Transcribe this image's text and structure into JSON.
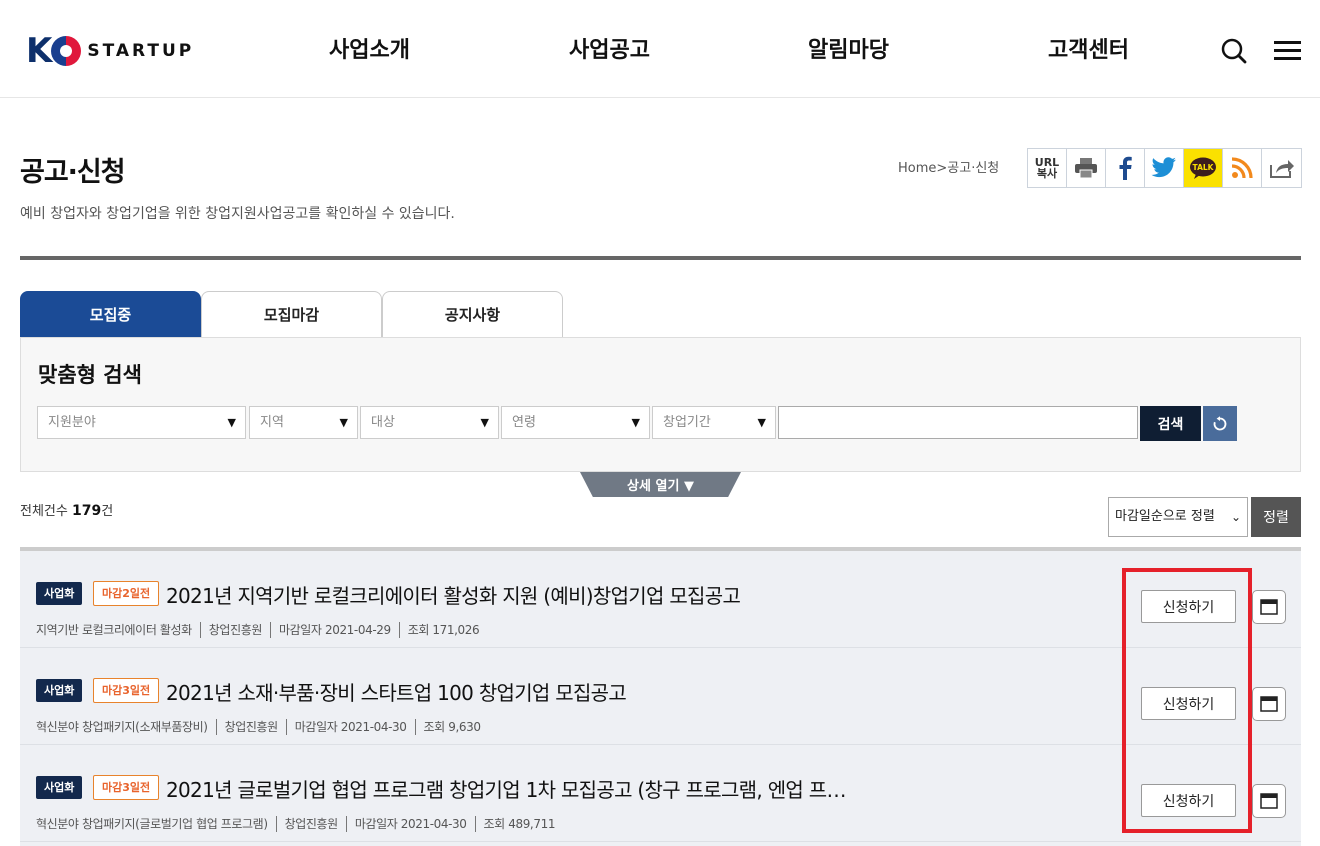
{
  "header": {
    "logo_text": "STARTUP",
    "logo_letter": "K",
    "nav": [
      "사업소개",
      "사업공고",
      "알림마당",
      "고객센터"
    ],
    "icons": [
      "search-icon",
      "menu-icon"
    ]
  },
  "page": {
    "title": "공고·신청",
    "description": "예비 창업자와 창업기업을 위한 창업지원사업공고를 확인하실 수 있습니다.",
    "breadcrumb": "Home>공고·신청",
    "share": {
      "url_copy": "URL\n복사",
      "talk": "TALK",
      "icons": [
        "url-copy-icon",
        "print-icon",
        "facebook-icon",
        "twitter-icon",
        "kakaotalk-icon",
        "rss-icon",
        "share-icon"
      ]
    }
  },
  "tabs": [
    {
      "label": "모집중",
      "active": true
    },
    {
      "label": "모집마감",
      "active": false
    },
    {
      "label": "공지사항",
      "active": false
    }
  ],
  "search": {
    "title": "맞춤형 검색",
    "filters": [
      {
        "placeholder": "지원분야"
      },
      {
        "placeholder": "지역"
      },
      {
        "placeholder": "대상"
      },
      {
        "placeholder": "연령"
      },
      {
        "placeholder": "창업기간"
      }
    ],
    "keyword_value": "",
    "search_label": "검색",
    "detail_toggle": "상세 열기 ▼"
  },
  "results": {
    "count_label": "전체건수",
    "count_value": "179",
    "count_unit": "건",
    "sort_selected": "마감일순으로 정렬",
    "sort_button": "정렬"
  },
  "items": [
    {
      "category": "사업화",
      "dday": "마감2일전",
      "title": "2021년 지역기반 로컬크리에이터 활성화 지원 (예비)창업기업 모집공고",
      "program": "지역기반 로컬크리에이터 활성화",
      "org": "창업진흥원",
      "deadline": "마감일자 2021-04-29",
      "views": "조회 171,026",
      "apply": "신청하기"
    },
    {
      "category": "사업화",
      "dday": "마감3일전",
      "title": "2021년 소재·부품·장비 스타트업 100 창업기업 모집공고",
      "program": "혁신분야 창업패키지(소재부품장비)",
      "org": "창업진흥원",
      "deadline": "마감일자 2021-04-30",
      "views": "조회 9,630",
      "apply": "신청하기"
    },
    {
      "category": "사업화",
      "dday": "마감3일전",
      "title": "2021년 글로벌기업 협업 프로그램 창업기업 1차 모집공고 (창구 프로그램, 엔업 프…",
      "program": "혁신분야 창업패키지(글로벌기업 협업 프로그램)",
      "org": "창업진흥원",
      "deadline": "마감일자 2021-04-30",
      "views": "조회 489,711",
      "apply": "신청하기"
    }
  ],
  "colors": {
    "primary": "#1b4b96",
    "navy": "#0f1e33",
    "highlight": "#e5202a",
    "dday": "#e8632c"
  }
}
